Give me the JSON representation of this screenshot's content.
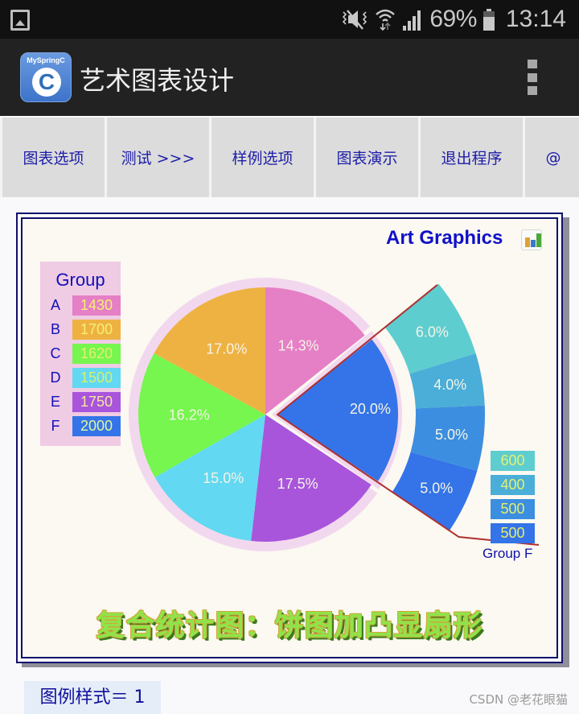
{
  "status_bar": {
    "battery_percent": "69%",
    "battery_level": 0.69,
    "time": "13:14",
    "icons": [
      "gallery-icon",
      "mute-vibrate-icon",
      "wifi-icon",
      "signal-icon",
      "battery-icon"
    ]
  },
  "app_bar": {
    "icon_label": "MySpringC",
    "icon_letter": "C",
    "title": "艺术图表设计",
    "overflow_icon": "more-vert-icon"
  },
  "tabs": [
    {
      "label": "图表选项"
    },
    {
      "label": "测试 >>>"
    },
    {
      "label": "样例选项"
    },
    {
      "label": "图表演示"
    },
    {
      "label": "退出程序"
    },
    {
      "label": "@"
    }
  ],
  "chart_header": {
    "title": "Art Graphics",
    "icon": "bar-chart-icon"
  },
  "chart_data": {
    "type": "pie",
    "title": "复合统计图：饼图加凸显扇形",
    "legend_title": "Group",
    "legend_placement": "left",
    "categories": [
      "A",
      "B",
      "C",
      "D",
      "E",
      "F"
    ],
    "values": [
      1430,
      1700,
      1620,
      1500,
      1750,
      2000
    ],
    "percent_labels": [
      "14.3%",
      "17.0%",
      "16.2%",
      "15.0%",
      "17.5%",
      "20.0%"
    ],
    "colors": [
      "#e57fc6",
      "#eeb243",
      "#76f64e",
      "#62d8f2",
      "#a855dc",
      "#3474e8"
    ],
    "legend_value_colors": [
      "#f6f070",
      "#f6f070",
      "#e6f070",
      "#d6f070",
      "#f6e6a0",
      "#e0f8a0"
    ],
    "slice_order_clockwise_from_top": [
      "A",
      "F",
      "E",
      "D",
      "C",
      "B"
    ],
    "exploded": "F",
    "sub_breakdown": {
      "group_label": "Group F",
      "values": [
        600,
        400,
        500,
        500
      ],
      "percent_labels": [
        "6.0%",
        "4.0%",
        "5.0%",
        "5.0%"
      ],
      "colors": [
        "#5ecdd0",
        "#4aaed8",
        "#3c8ee0",
        "#3474e8"
      ]
    },
    "ring_color": "#f2d8ee",
    "connector_color": "#b03030"
  },
  "footer": {
    "legend_style_label": "图例样式＝ 1",
    "watermark": "CSDN @老花眼猫"
  }
}
